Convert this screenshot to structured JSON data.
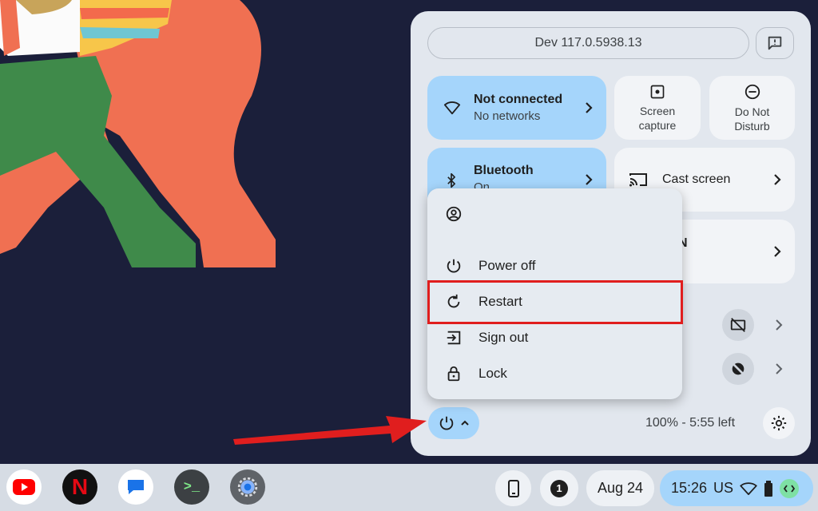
{
  "quick_settings": {
    "version_label": "Dev 117.0.5938.13",
    "network": {
      "title": "Not connected",
      "subtitle": "No networks"
    },
    "screen_capture": {
      "line1": "Screen",
      "line2": "capture"
    },
    "do_not_disturb": {
      "line1": "Do Not",
      "line2": "Disturb"
    },
    "bluetooth": {
      "title": "Bluetooth",
      "subtitle": "On"
    },
    "cast": {
      "title": "Cast screen"
    },
    "hidden_tile_partial": "N",
    "battery_text": "100% - 5:55 left"
  },
  "power_menu": {
    "items": [
      {
        "label": "",
        "icon": "account-circle-icon"
      },
      {
        "label": "Power off",
        "icon": "power-icon"
      },
      {
        "label": "Restart",
        "icon": "restart-icon"
      },
      {
        "label": "Sign out",
        "icon": "sign-out-icon"
      },
      {
        "label": "Lock",
        "icon": "lock-icon"
      }
    ],
    "highlighted_item": "Restart"
  },
  "shelf": {
    "apps": [
      {
        "name": "YouTube",
        "icon": "youtube-icon"
      },
      {
        "name": "Netflix",
        "icon": "netflix-icon"
      },
      {
        "name": "Messages",
        "icon": "messages-icon"
      },
      {
        "name": "Terminal",
        "icon": "terminal-icon"
      },
      {
        "name": "Settings",
        "icon": "settings-icon"
      }
    ],
    "netflix_glyph": "N",
    "terminal_glyph": ">_",
    "notification_count": "1",
    "date": "Aug 24",
    "time": "15:26",
    "locale": "US"
  },
  "colors": {
    "accent_blue": "#a5d5fb",
    "annotation_red": "#e01e1e",
    "panel_bg": "#e2e7ee",
    "desktop_bg": "#1b1f3a"
  }
}
